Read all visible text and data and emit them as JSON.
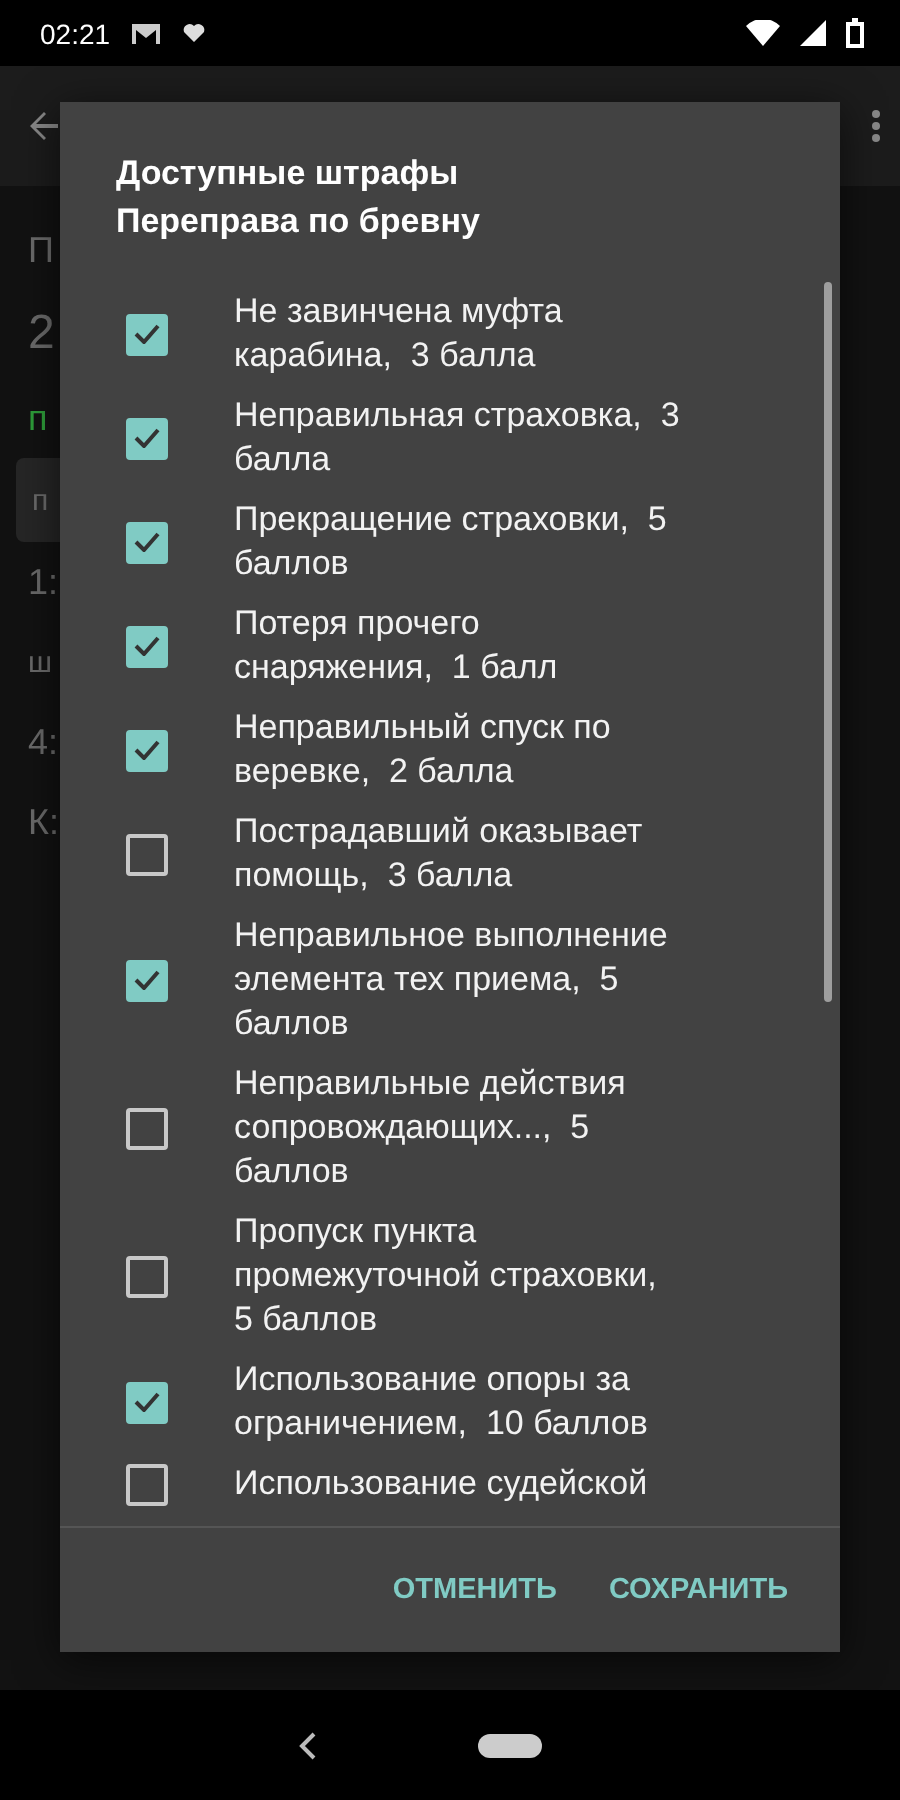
{
  "status_bar": {
    "time": "02:21"
  },
  "background": {
    "fragments": [
      {
        "text": "П",
        "kind": "text"
      },
      {
        "text": "2",
        "kind": "large"
      },
      {
        "text": "п",
        "kind": "green"
      },
      {
        "text": "п",
        "kind": "button"
      },
      {
        "text": "1:",
        "kind": "text"
      },
      {
        "text": "ш",
        "kind": "small"
      },
      {
        "text": "4:",
        "kind": "text"
      },
      {
        "text": "К:",
        "kind": "text"
      }
    ]
  },
  "dialog": {
    "title": "Доступные штрафы",
    "subtitle": "Переправа по бревну",
    "items": [
      {
        "lines": [
          "Не завинчена муфта",
          "карабина,  3 балла"
        ],
        "checked": true
      },
      {
        "lines": [
          "Неправильная страховка,  3",
          "балла"
        ],
        "checked": true
      },
      {
        "lines": [
          "Прекращение страховки,  5",
          "баллов"
        ],
        "checked": true
      },
      {
        "lines": [
          "Потеря прочего",
          "снаряжения,  1 балл"
        ],
        "checked": true
      },
      {
        "lines": [
          "Неправильный спуск по",
          "веревке,  2 балла"
        ],
        "checked": true
      },
      {
        "lines": [
          "Пострадавший оказывает",
          "помощь,  3 балла"
        ],
        "checked": false
      },
      {
        "lines": [
          "Неправильное выполнение",
          "элемента тех приема,  5",
          "баллов"
        ],
        "checked": true
      },
      {
        "lines": [
          "Неправильные действия",
          "сопровождающих...,  5",
          "баллов"
        ],
        "checked": false
      },
      {
        "lines": [
          "Пропуск пункта",
          "промежуточной страховки,",
          "5 баллов"
        ],
        "checked": false
      },
      {
        "lines": [
          "Использование опоры за",
          "ограничением,  10 баллов"
        ],
        "checked": true
      },
      {
        "lines": [
          "Использование судейской"
        ],
        "checked": false
      }
    ],
    "buttons": [
      "ОТМЕНИТЬ",
      "СОХРАНИТЬ"
    ]
  }
}
